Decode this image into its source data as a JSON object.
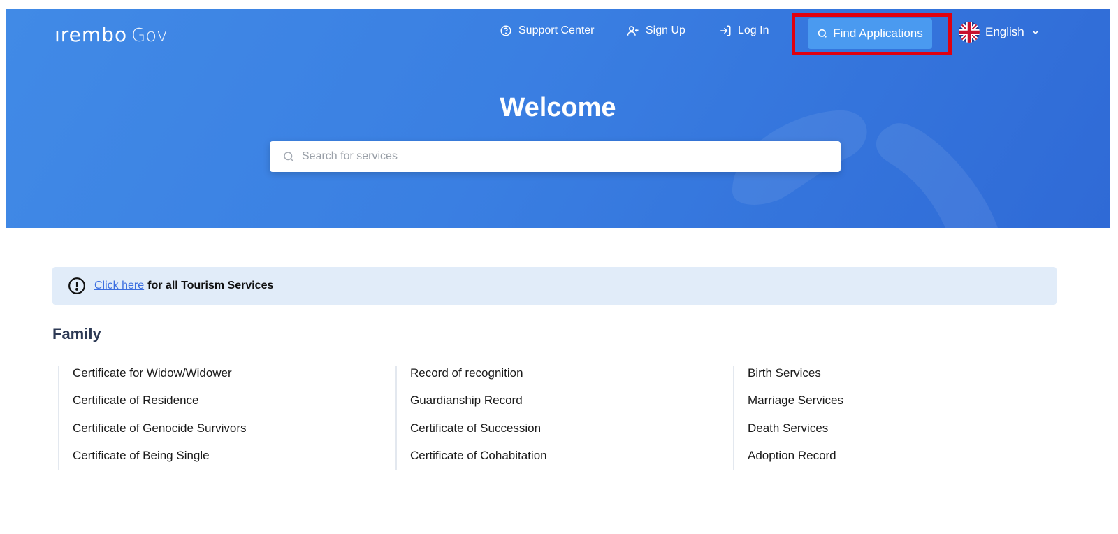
{
  "header": {
    "logo_mark": "ırembo",
    "logo_suffix": "Gov",
    "nav": [
      {
        "label": "Support Center",
        "icon": "help-circle-icon"
      },
      {
        "label": "Sign Up",
        "icon": "user-plus-icon"
      },
      {
        "label": "Log In",
        "icon": "log-in-icon"
      }
    ],
    "find_button": {
      "label": "Find Applications",
      "icon": "search-icon"
    },
    "language": {
      "label": "English",
      "flag": "uk-flag-icon"
    }
  },
  "hero": {
    "title": "Welcome",
    "search_placeholder": "Search for services"
  },
  "alert": {
    "link_text": "Click here",
    "text": "for all Tourism Services"
  },
  "family": {
    "title": "Family",
    "columns": [
      [
        "Certificate for Widow/Widower",
        "Certificate of Residence",
        "Certificate of Genocide Survivors",
        "Certificate of Being Single"
      ],
      [
        "Record of recognition",
        "Guardianship Record",
        "Certificate of Succession",
        "Certificate of Cohabitation"
      ],
      [
        "Birth Services",
        "Marriage Services",
        "Death Services",
        "Adoption Record"
      ]
    ]
  },
  "colors": {
    "hero_blue": "#3a7fe2",
    "button_blue": "#4a9af0",
    "highlight_red": "#e0000f",
    "alert_bg": "#e1ecf9",
    "link_blue": "#3b6ee0"
  }
}
